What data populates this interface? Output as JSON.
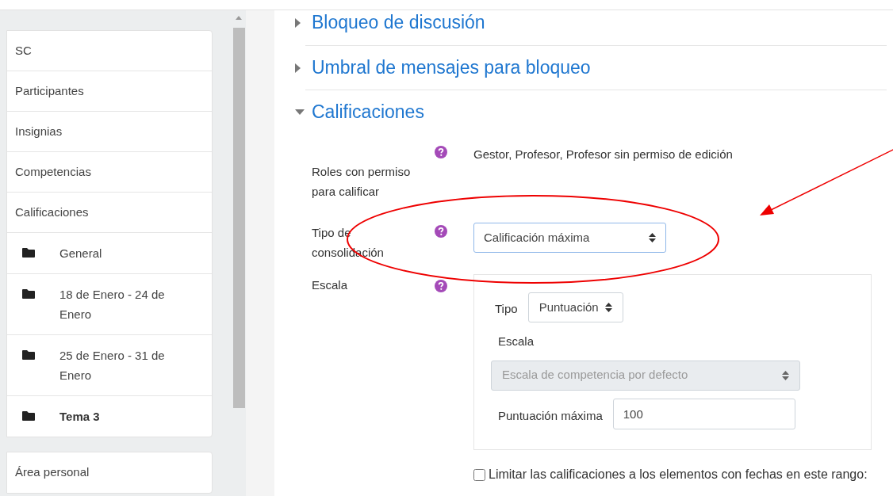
{
  "sidebar": {
    "nav": [
      {
        "kind": "link",
        "label": "SC",
        "selected": false
      },
      {
        "kind": "link",
        "label": "Participantes",
        "selected": false
      },
      {
        "kind": "link",
        "label": "Insignias",
        "selected": false
      },
      {
        "kind": "link",
        "label": "Competencias",
        "selected": false
      },
      {
        "kind": "link",
        "label": "Calificaciones",
        "selected": false
      },
      {
        "kind": "folder",
        "label": "General",
        "selected": false
      },
      {
        "kind": "folder",
        "label": "18 de Enero - 24 de Enero",
        "selected": false
      },
      {
        "kind": "folder",
        "label": "25 de Enero - 31 de Enero",
        "selected": false
      },
      {
        "kind": "folder",
        "label": "Tema 3",
        "selected": true
      }
    ],
    "second_nav": [
      {
        "kind": "link",
        "label": "Área personal",
        "selected": false
      }
    ]
  },
  "sections": [
    {
      "title": "Bloqueo de discusión",
      "expanded": false
    },
    {
      "title": "Umbral de mensajes para bloqueo",
      "expanded": false
    },
    {
      "title": "Calificaciones",
      "expanded": true
    }
  ],
  "grading": {
    "roles": {
      "label": "Roles con permiso para calificar",
      "value": "Gestor, Profesor, Profesor sin permiso de edición"
    },
    "aggregation": {
      "label": "Tipo de consolidación",
      "value": "Calificación máxima"
    },
    "scale": {
      "label": "Escala",
      "type_label": "Tipo",
      "type_value": "Puntuación",
      "scale_label": "Escala",
      "scale_value": "Escala de competencia por defecto",
      "scale_disabled": true,
      "max_label": "Puntuación máxima",
      "max_value": "100"
    },
    "limit": {
      "label": "Limitar las calificaciones a los elementos con fechas en este rango:",
      "checked": false
    }
  }
}
